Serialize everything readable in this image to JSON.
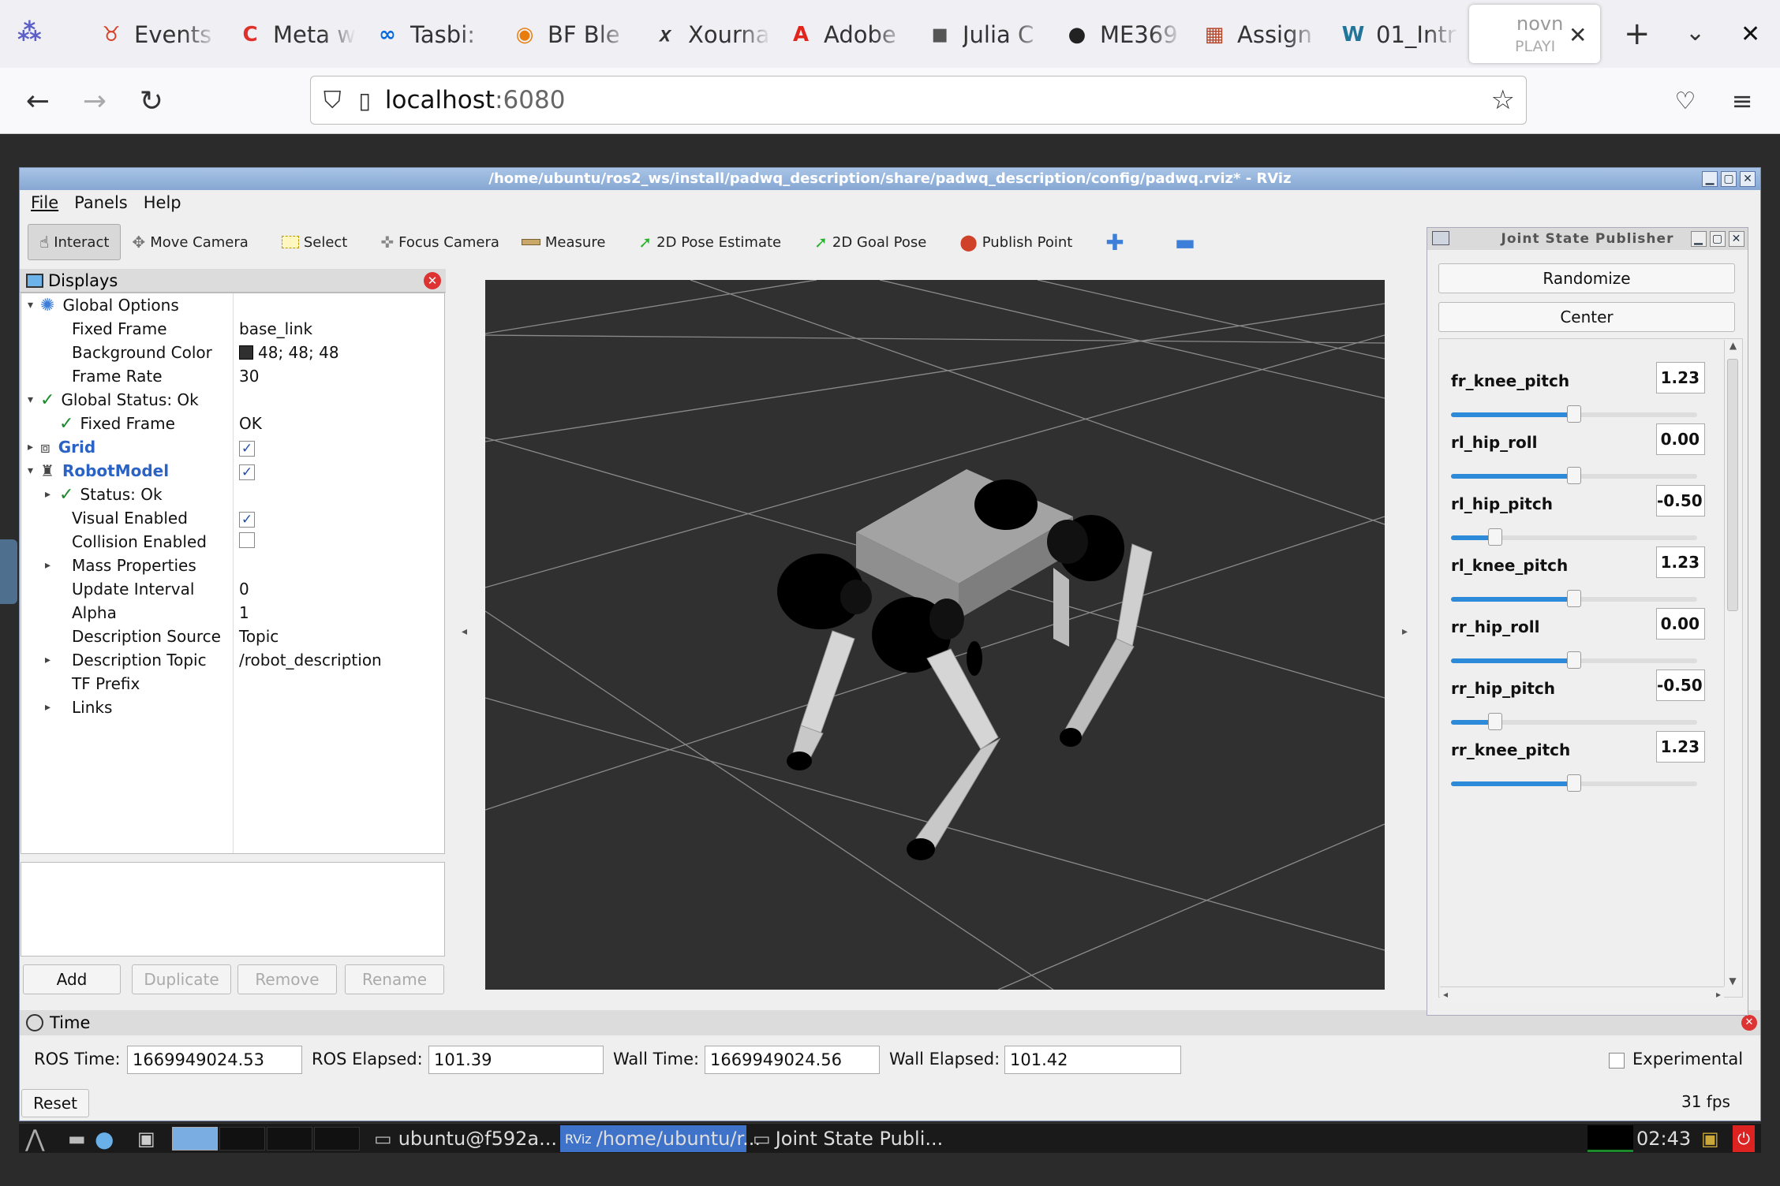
{
  "browser": {
    "tabs": [
      {
        "label": "Events",
        "icon_color": "#d7442c"
      },
      {
        "label": "Meta w",
        "icon_color": "#e0302a"
      },
      {
        "label": "Tasbi:",
        "icon_color": "#0668e1"
      },
      {
        "label": "BF Ble",
        "icon_color": "#e87d0d"
      },
      {
        "label": "Xourna",
        "icon_color": "#333333"
      },
      {
        "label": "Adobe",
        "icon_color": "#e1251b"
      },
      {
        "label": "Julia C",
        "icon_color": "#555555"
      },
      {
        "label": "ME369",
        "icon_color": "#222222"
      },
      {
        "label": "Assign",
        "icon_color": "#b5462a"
      },
      {
        "label": "01_Intr",
        "icon_color": "#21759b"
      }
    ],
    "active_tab": {
      "line1": "novn",
      "line2": "PLAYI"
    },
    "url_host": "localhost",
    "url_port": ":6080"
  },
  "rviz": {
    "title": "/home/ubuntu/ros2_ws/install/padwq_description/share/padwq_description/config/padwq.rviz* - RViz",
    "menu": [
      "File",
      "Panels",
      "Help"
    ],
    "tools": [
      "Interact",
      "Move Camera",
      "Select",
      "Focus Camera",
      "Measure",
      "2D Pose Estimate",
      "2D Goal Pose",
      "Publish Point"
    ],
    "displays_title": "Displays",
    "tree": {
      "global_options": "Global Options",
      "fixed_frame_label": "Fixed Frame",
      "fixed_frame_value": "base_link",
      "bg_color_label": "Background Color",
      "bg_color_value": "48; 48; 48",
      "frame_rate_label": "Frame Rate",
      "frame_rate_value": "30",
      "global_status": "Global Status: Ok",
      "gs_fixed_frame": "Fixed Frame",
      "gs_fixed_frame_value": "OK",
      "grid": "Grid",
      "robot_model": "RobotModel",
      "status_ok": "Status: Ok",
      "visual_enabled": "Visual Enabled",
      "collision_enabled": "Collision Enabled",
      "mass_properties": "Mass Properties",
      "update_interval": "Update Interval",
      "update_interval_value": "0",
      "alpha": "Alpha",
      "alpha_value": "1",
      "description_source": "Description Source",
      "description_source_value": "Topic",
      "description_topic": "Description Topic",
      "description_topic_value": "/robot_description",
      "tf_prefix": "TF Prefix",
      "links": "Links"
    },
    "buttons": {
      "add": "Add",
      "duplicate": "Duplicate",
      "remove": "Remove",
      "rename": "Rename"
    },
    "time_title": "Time",
    "time": {
      "ros_time_label": "ROS Time:",
      "ros_time": "1669949024.53",
      "ros_elapsed_label": "ROS Elapsed:",
      "ros_elapsed": "101.39",
      "wall_time_label": "Wall Time:",
      "wall_time": "1669949024.56",
      "wall_elapsed_label": "Wall Elapsed:",
      "wall_elapsed": "101.42",
      "experimental": "Experimental",
      "reset": "Reset",
      "fps": "31 fps"
    }
  },
  "jsp": {
    "title": "Joint State Publisher",
    "randomize": "Randomize",
    "center": "Center",
    "joints": [
      {
        "name": "fr_knee_pitch",
        "value": "1.23",
        "fraction": 0.5
      },
      {
        "name": "rl_hip_roll",
        "value": "0.00",
        "fraction": 0.5
      },
      {
        "name": "rl_hip_pitch",
        "value": "-0.50",
        "fraction": 0.18
      },
      {
        "name": "rl_knee_pitch",
        "value": "1.23",
        "fraction": 0.5
      },
      {
        "name": "rr_hip_roll",
        "value": "0.00",
        "fraction": 0.5
      },
      {
        "name": "rr_hip_pitch",
        "value": "-0.50",
        "fraction": 0.18
      },
      {
        "name": "rr_knee_pitch",
        "value": "1.23",
        "fraction": 0.5
      }
    ]
  },
  "taskbar": {
    "terminal": "ubuntu@f592a...",
    "rviz": "/home/ubuntu/r...",
    "jsp": "Joint State Publi...",
    "clock": "02:43"
  }
}
